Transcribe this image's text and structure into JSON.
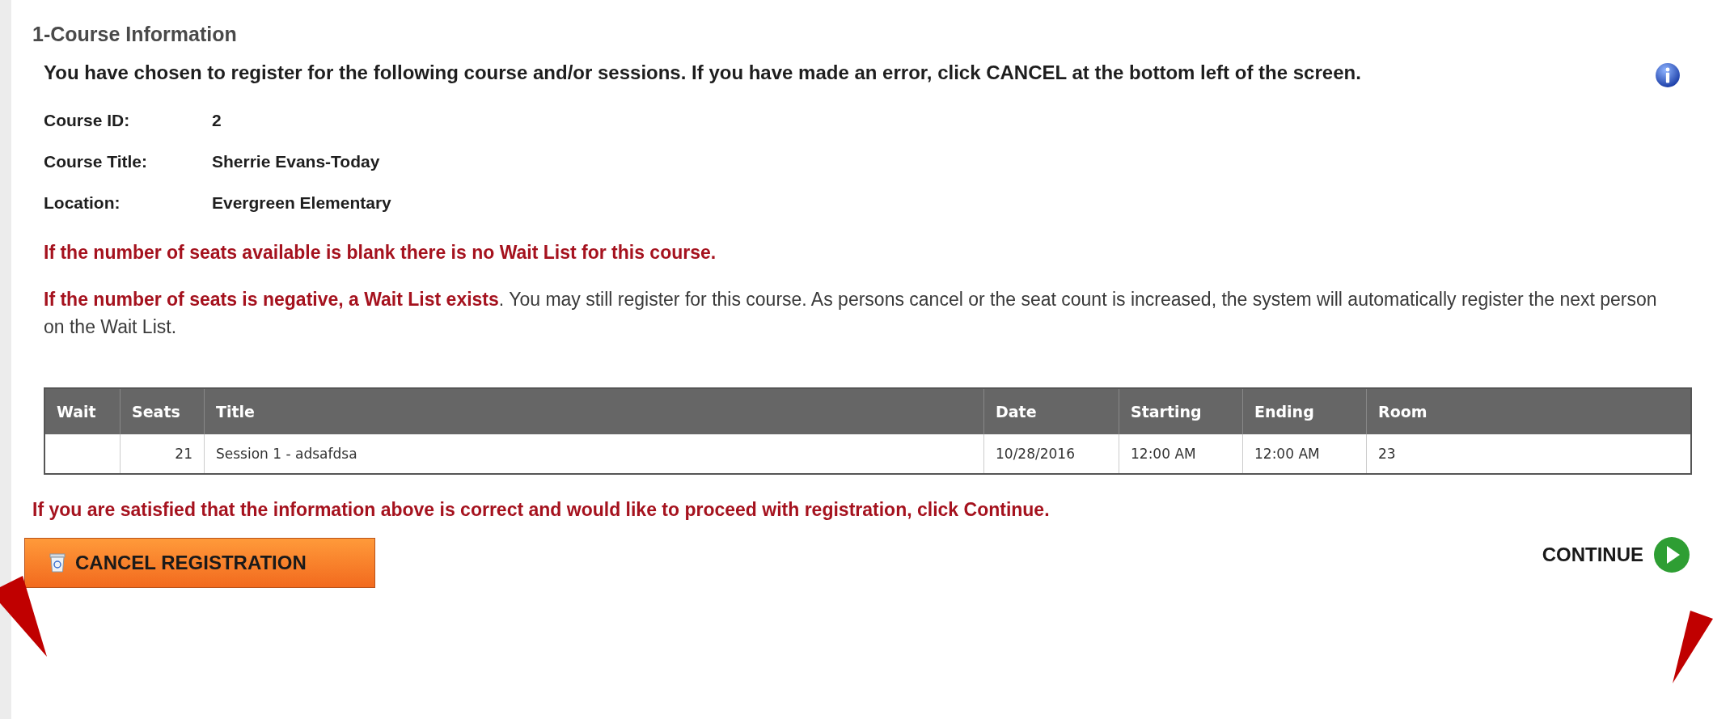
{
  "section": {
    "title": "1-Course Information"
  },
  "intro": "You have chosen to register for the following course and/or sessions. If you have made an error, click CANCEL at the bottom left of the screen.",
  "details": [
    {
      "label": "Course ID:",
      "value": "2"
    },
    {
      "label": "Course Title:",
      "value": "Sherrie Evans-Today"
    },
    {
      "label": "Location:",
      "value": "Evergreen Elementary"
    }
  ],
  "notices": [
    {
      "kind": "alert",
      "text": "If the number of seats available is blank there is no Wait List for this course."
    },
    {
      "kind": "mixed",
      "text": "**If the number of seats is negative, a Wait List exists**. You may still register for this course. As persons cancel or the seat count is increased, the system will automatically register the next person on the Wait List."
    }
  ],
  "table": {
    "columns": [
      "Wait",
      "Seats",
      "Title",
      "Date",
      "Starting",
      "Ending",
      "Room"
    ],
    "rows": [
      {
        "seats": "21",
        "title": "Session 1 - adsafdsa",
        "date": "10/28/2016",
        "starting": "12:00 AM",
        "ending": "12:00 AM",
        "room": "23"
      }
    ]
  },
  "confirm_notice": "If you are satisfied that the information above is correct and would like to proceed with registration, click Continue.",
  "cancel_button": {
    "label": "CANCEL REGISTRATION"
  },
  "continue_button": {
    "label": "CONTINUE"
  }
}
